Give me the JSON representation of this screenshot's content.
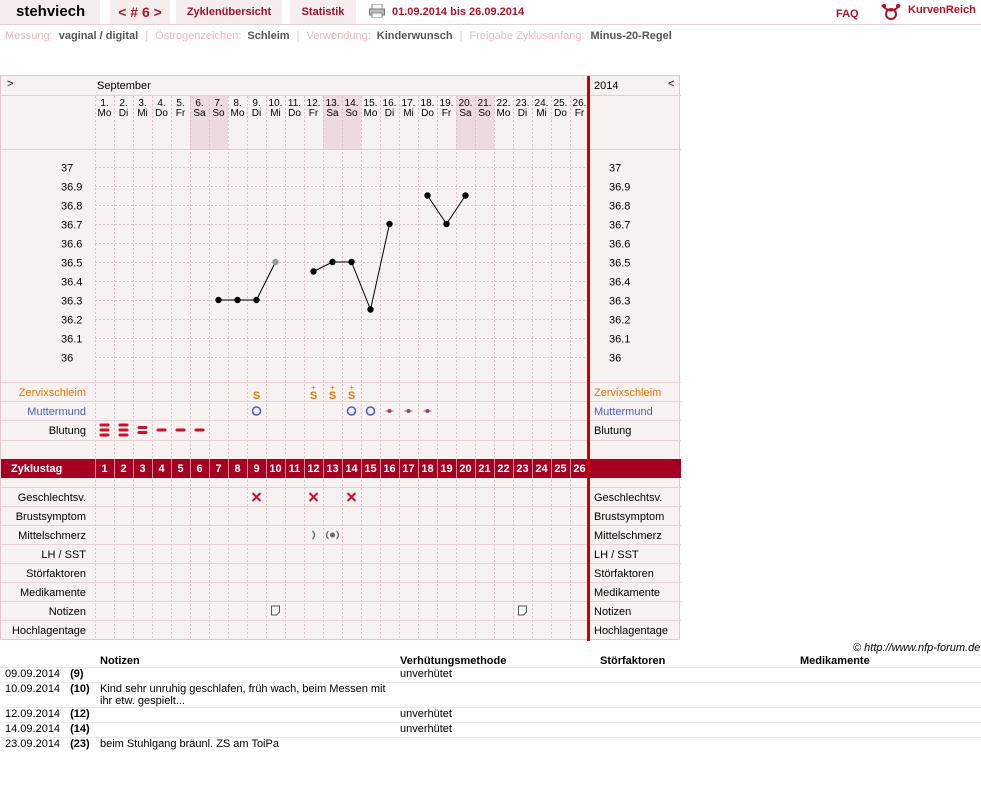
{
  "header": {
    "user": "stehviech",
    "cycle_nav": "< # 6 >",
    "tab_overview": "Zyklenübersicht",
    "tab_stats": "Statistik",
    "date_range": "01.09.2014 bis 26.09.2014",
    "faq": "FAQ",
    "logo": "KurvenReich"
  },
  "meta": [
    {
      "key": "Messung:",
      "value": "vaginal / digital"
    },
    {
      "key": "Östrogenzeichen:",
      "value": "Schleim"
    },
    {
      "key": "Verwendung:",
      "value": "Kinderwunsch"
    },
    {
      "key": "Freigabe Zyklusanfang:",
      "value": "Minus-20-Regel"
    }
  ],
  "chart": {
    "nav_left": ">",
    "nav_right": "<",
    "month": "September",
    "year": "2014",
    "days": [
      {
        "d": "1.",
        "w": "Mo"
      },
      {
        "d": "2.",
        "w": "Di"
      },
      {
        "d": "3.",
        "w": "Mi"
      },
      {
        "d": "4.",
        "w": "Do"
      },
      {
        "d": "5.",
        "w": "Fr"
      },
      {
        "d": "6.",
        "w": "Sa"
      },
      {
        "d": "7.",
        "w": "So"
      },
      {
        "d": "8.",
        "w": "Mo"
      },
      {
        "d": "9.",
        "w": "Di"
      },
      {
        "d": "10.",
        "w": "Mi"
      },
      {
        "d": "11.",
        "w": "Do"
      },
      {
        "d": "12.",
        "w": "Fr"
      },
      {
        "d": "13.",
        "w": "Sa"
      },
      {
        "d": "14.",
        "w": "So"
      },
      {
        "d": "15.",
        "w": "Mo"
      },
      {
        "d": "16.",
        "w": "Di"
      },
      {
        "d": "17.",
        "w": "Mi"
      },
      {
        "d": "18.",
        "w": "Do"
      },
      {
        "d": "19.",
        "w": "Fr"
      },
      {
        "d": "20.",
        "w": "Sa"
      },
      {
        "d": "21.",
        "w": "So"
      },
      {
        "d": "22.",
        "w": "Mo"
      },
      {
        "d": "23.",
        "w": "Di"
      },
      {
        "d": "24.",
        "w": "Mi"
      },
      {
        "d": "25.",
        "w": "Do"
      },
      {
        "d": "26.",
        "w": "Fr"
      }
    ],
    "shaded_days": [
      6,
      7,
      13,
      14,
      20,
      21
    ],
    "temp_ticks": [
      "37",
      "36.9",
      "36.8",
      "36.7",
      "36.6",
      "36.5",
      "36.4",
      "36.3",
      "36.2",
      "36.1",
      "36"
    ],
    "rows_top": [
      "Zervixschleim",
      "Muttermund",
      "Blutung"
    ],
    "zyklustag_label": "Zyklustag",
    "cycle_days": [
      "1",
      "2",
      "3",
      "4",
      "5",
      "6",
      "7",
      "8",
      "9",
      "10",
      "11",
      "12",
      "13",
      "14",
      "15",
      "16",
      "17",
      "18",
      "19",
      "20",
      "21",
      "22",
      "23",
      "24",
      "25",
      "26"
    ],
    "rows_bottom": [
      "Geschlechtsv.",
      "Brustsymptom",
      "Mittelschmerz",
      "LH / SST",
      "Störfaktoren",
      "Medikamente",
      "Notizen",
      "Hochlagentage"
    ],
    "colors": {
      "accent": "#a50021",
      "zervix": "#e07800",
      "muttermund": "#4a5fc8",
      "bleeding": "#d0102a",
      "redline": "#cc0000"
    },
    "zervix_symbols": [
      {
        "day": 9,
        "symbol": "S"
      },
      {
        "day": 12,
        "symbol": "S+"
      },
      {
        "day": 13,
        "symbol": "S+"
      },
      {
        "day": 14,
        "symbol": "S+"
      }
    ],
    "muttermund": [
      {
        "day": 9,
        "kind": "open"
      },
      {
        "day": 14,
        "kind": "open"
      },
      {
        "day": 15,
        "kind": "open"
      },
      {
        "day": 16,
        "kind": "closed"
      },
      {
        "day": 17,
        "kind": "closed"
      },
      {
        "day": 18,
        "kind": "closed"
      }
    ],
    "bleeding": [
      {
        "day": 1,
        "level": "stark"
      },
      {
        "day": 2,
        "level": "stark"
      },
      {
        "day": 3,
        "level": "mittel"
      },
      {
        "day": 4,
        "level": "leicht"
      },
      {
        "day": 5,
        "level": "leicht"
      },
      {
        "day": 6,
        "level": "leicht"
      }
    ],
    "intercourse_days": [
      9,
      12,
      14
    ],
    "mittelschmerz_days": [
      12,
      13
    ],
    "note_days": [
      10,
      23
    ],
    "copyright": "© http://www.nfp-forum.de"
  },
  "chart_data": {
    "type": "line",
    "x": [
      7,
      8,
      9,
      10,
      12,
      13,
      14,
      15,
      16,
      18,
      19,
      20
    ],
    "y": [
      36.3,
      36.3,
      36.3,
      36.5,
      36.45,
      36.5,
      36.5,
      36.25,
      36.7,
      36.85,
      36.7,
      36.85
    ],
    "excluded_points": [
      10
    ],
    "ylim": [
      36.0,
      37.0
    ],
    "xlim": [
      1,
      26
    ],
    "segments": [
      [
        7,
        8,
        9,
        10
      ],
      [
        12,
        13,
        14,
        15,
        16
      ],
      [
        18,
        19,
        20
      ]
    ]
  },
  "notes_table": {
    "headers": [
      "",
      "Notizen",
      "Verhütungsmethode",
      "Störfaktoren",
      "Medikamente"
    ],
    "rows": [
      {
        "date": "09.09.2014",
        "day": "(9)",
        "note": "",
        "method": "unverhütet",
        "stoer": "",
        "med": ""
      },
      {
        "date": "10.09.2014",
        "day": "(10)",
        "note": "Kind sehr unruhig geschlafen, früh wach, beim Messen mit ihr etw. gespielt...",
        "method": "",
        "stoer": "",
        "med": ""
      },
      {
        "date": "12.09.2014",
        "day": "(12)",
        "note": "",
        "method": "unverhütet",
        "stoer": "",
        "med": ""
      },
      {
        "date": "14.09.2014",
        "day": "(14)",
        "note": "",
        "method": "unverhütet",
        "stoer": "",
        "med": ""
      },
      {
        "date": "23.09.2014",
        "day": "(23)",
        "note": "beim Stuhlgang bräunl. ZS am ToiPa",
        "method": "",
        "stoer": "",
        "med": ""
      }
    ]
  }
}
